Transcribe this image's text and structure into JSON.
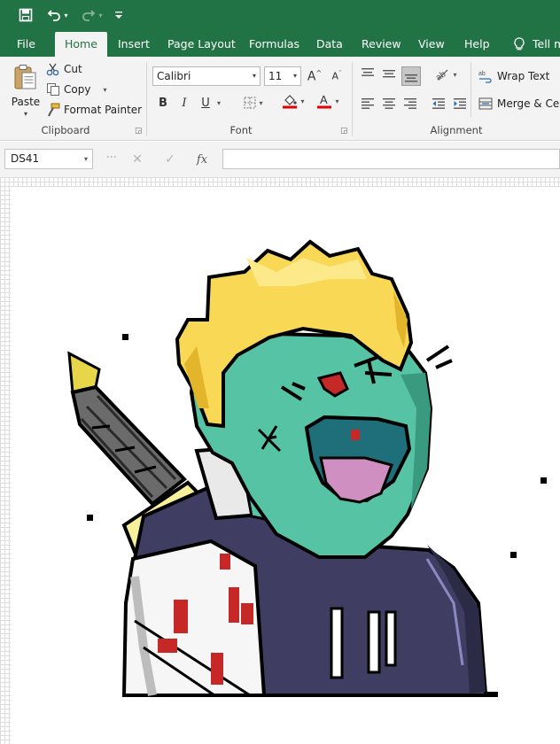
{
  "quick_access": {
    "save_icon": "save-icon",
    "undo_icon": "undo-icon",
    "redo_icon": "redo-icon",
    "customize_icon": "customize-qat-icon"
  },
  "tabs": [
    {
      "label": "File"
    },
    {
      "label": "Home"
    },
    {
      "label": "Insert"
    },
    {
      "label": "Page Layout"
    },
    {
      "label": "Formulas"
    },
    {
      "label": "Data"
    },
    {
      "label": "Review"
    },
    {
      "label": "View"
    },
    {
      "label": "Help"
    }
  ],
  "tell_me": "Tell m",
  "clipboard": {
    "paste_label": "Paste",
    "cut_label": "Cut",
    "copy_label": "Copy",
    "format_painter_label": "Format Painter",
    "group_label": "Clipboard"
  },
  "font": {
    "name": "Calibri",
    "size": "11",
    "bold": "B",
    "italic": "I",
    "underline": "U",
    "group_label": "Font"
  },
  "alignment": {
    "wrap_text": "Wrap Text",
    "merge_center": "Merge & Cen",
    "group_label": "Alignment"
  },
  "formula_bar": {
    "name_box": "DS41",
    "cancel": "✕",
    "enter": "✓",
    "fx": "fx",
    "formula": ""
  },
  "colors": {
    "excel_green": "#217346",
    "ribbon_bg": "#f3f3f3",
    "hair_yellow": "#f9d856",
    "skin_teal": "#56c4a4",
    "hoodie_navy": "#3f3e62",
    "blood_red": "#c62828",
    "tongue_pink": "#cf8fc0",
    "knife_gray": "#6e6e6e"
  }
}
